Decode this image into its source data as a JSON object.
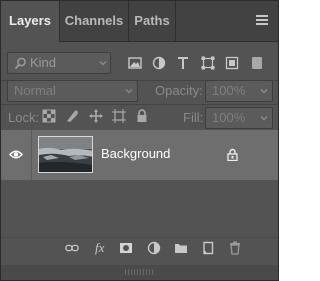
{
  "tabs": [
    {
      "label": "Layers",
      "active": true
    },
    {
      "label": "Channels",
      "active": false
    },
    {
      "label": "Paths",
      "active": false
    }
  ],
  "filter": {
    "kind_label": "Kind",
    "icons": [
      "pixel-filter-icon",
      "adjustment-filter-icon",
      "type-filter-icon",
      "shape-filter-icon",
      "smart-object-filter-icon",
      "filter-toggle-icon"
    ]
  },
  "blend": {
    "mode_value": "Normal",
    "opacity_label": "Opacity:",
    "opacity_value": "100%"
  },
  "lock": {
    "lock_label": "Lock:",
    "icons": [
      "lock-transparent-icon",
      "lock-image-icon",
      "lock-position-icon",
      "lock-artboard-icon",
      "lock-all-icon"
    ],
    "fill_label": "Fill:",
    "fill_value": "100%"
  },
  "layers": [
    {
      "name": "Background",
      "visible": true,
      "locked": true,
      "selected": true
    }
  ],
  "footer_icons": [
    "link-layers-icon",
    "fx-icon",
    "layer-mask-icon",
    "adjustment-layer-icon",
    "group-folder-icon",
    "new-layer-icon",
    "delete-trash-icon"
  ],
  "footer_fx_text": "fx",
  "colors": {
    "panel_bg": "#535353",
    "tabbar_bg": "#424242",
    "selected_row": "#6e6e6e",
    "text_light": "#ececec",
    "text_dim": "#8a8a8a"
  }
}
